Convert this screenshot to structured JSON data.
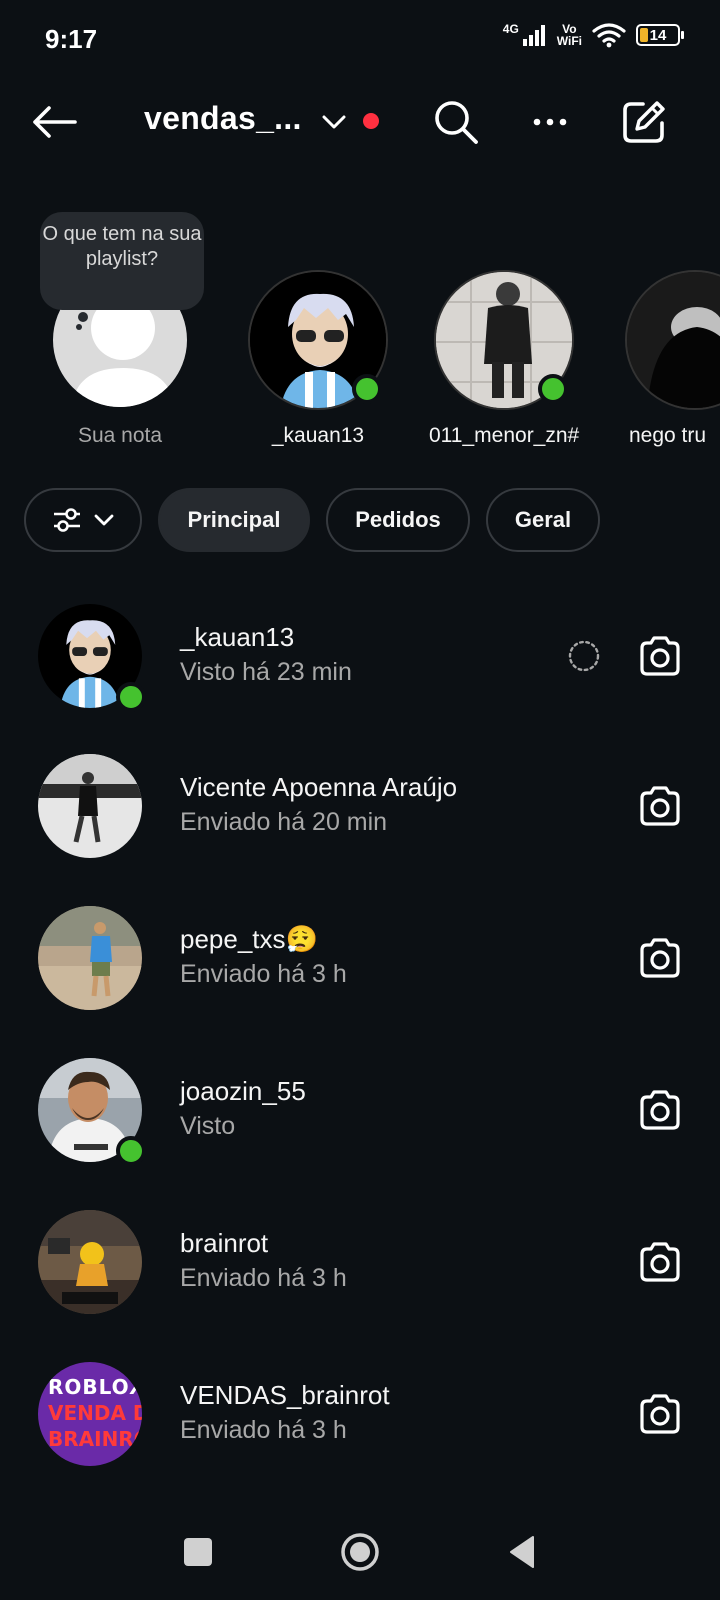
{
  "status": {
    "time": "9:17",
    "network": "4G",
    "vowifi_top": "Vo",
    "vowifi_bottom": "WiFi",
    "battery": "14"
  },
  "header": {
    "title": "vendas_...",
    "icons": [
      "back-arrow-icon",
      "chevron-down-icon",
      "search-icon",
      "more-icon",
      "compose-icon"
    ]
  },
  "notes": {
    "bubble_text": "O que tem na sua playlist?",
    "items": [
      {
        "name": "Sua nota"
      },
      {
        "name": "_kauan13"
      },
      {
        "name": "011_menor_zn#"
      },
      {
        "name": "nego tru"
      }
    ]
  },
  "filters": [
    {
      "label": "Principal"
    },
    {
      "label": "Pedidos"
    },
    {
      "label": "Geral"
    }
  ],
  "conversations": [
    {
      "name": "_kauan13",
      "status": "Visto há 23 min"
    },
    {
      "name": "Vicente Apoenna Araújo",
      "status": "Enviado há 20 min"
    },
    {
      "name": "pepe_txs😮‍💨",
      "status": "Enviado há 3 h"
    },
    {
      "name": "joaozin_55",
      "status": "Visto"
    },
    {
      "name": "brainrot",
      "status": "Enviado há 3 h"
    },
    {
      "name": "VENDAS_brainrot",
      "status": "Enviado há 3 h",
      "avatar_lines": [
        "ROBLOX",
        "VENDA DE",
        "BRAINROT"
      ]
    }
  ],
  "colors": {
    "background": "#0c1014",
    "online": "#45c22f",
    "notification": "#ff3040",
    "chip_active": "#262a2f"
  }
}
